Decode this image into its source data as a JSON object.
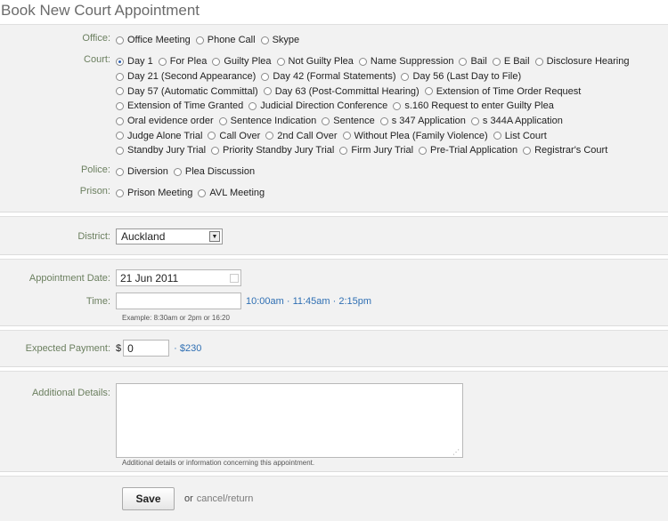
{
  "page_title": "Book New Court Appointment",
  "office": {
    "label": "Office:",
    "options": [
      "Office Meeting",
      "Phone Call",
      "Skype"
    ]
  },
  "court": {
    "label": "Court:",
    "lines": [
      [
        "Day 1",
        "For Plea",
        "Guilty Plea",
        "Not Guilty Plea",
        "Name Suppression",
        "Bail",
        "E Bail",
        "Disclosure Hearing"
      ],
      [
        "Day 21 (Second Appearance)",
        "Day 42 (Formal Statements)",
        "Day 56 (Last Day to File)"
      ],
      [
        "Day 57 (Automatic Committal)",
        "Day 63 (Post-Committal Hearing)",
        "Extension of Time Order Request"
      ],
      [
        "Extension of Time Granted",
        "Judicial Direction Conference",
        "s.160 Request to enter Guilty Plea"
      ],
      [
        "Oral evidence order",
        "Sentence Indication",
        "Sentence",
        "s 347 Application",
        "s 344A Application"
      ],
      [
        "Judge Alone Trial",
        "Call Over",
        "2nd Call Over",
        "Without Plea (Family Violence)",
        "List Court"
      ],
      [
        "Standby Jury Trial",
        "Priority Standby Jury Trial",
        "Firm Jury Trial",
        "Pre-Trial Application",
        "Registrar's Court"
      ]
    ],
    "selected": "Day 1"
  },
  "police": {
    "label": "Police:",
    "options": [
      "Diversion",
      "Plea Discussion"
    ]
  },
  "prison": {
    "label": "Prison:",
    "options": [
      "Prison Meeting",
      "AVL Meeting"
    ]
  },
  "district": {
    "label": "District:",
    "value": "Auckland"
  },
  "appointment_date": {
    "label": "Appointment Date:",
    "value": "21 Jun 2011"
  },
  "time": {
    "label": "Time:",
    "value": "",
    "quick_times": "10:00am · 11:45am · 2:15pm",
    "example": "Example: 8:30am or 2pm or 16:20"
  },
  "payment": {
    "label": "Expected Payment:",
    "currency": "$",
    "value": "0",
    "suggestion": "· $230"
  },
  "details": {
    "label": "Additional Details:",
    "value": "",
    "hint": "Additional details or information concerning this appointment."
  },
  "actions": {
    "save": "Save",
    "or": "or",
    "cancel": "cancel/return"
  },
  "colors": {
    "label": "#6b7f5f",
    "link": "#2f6fb3",
    "panel": "#f2f2f2"
  }
}
